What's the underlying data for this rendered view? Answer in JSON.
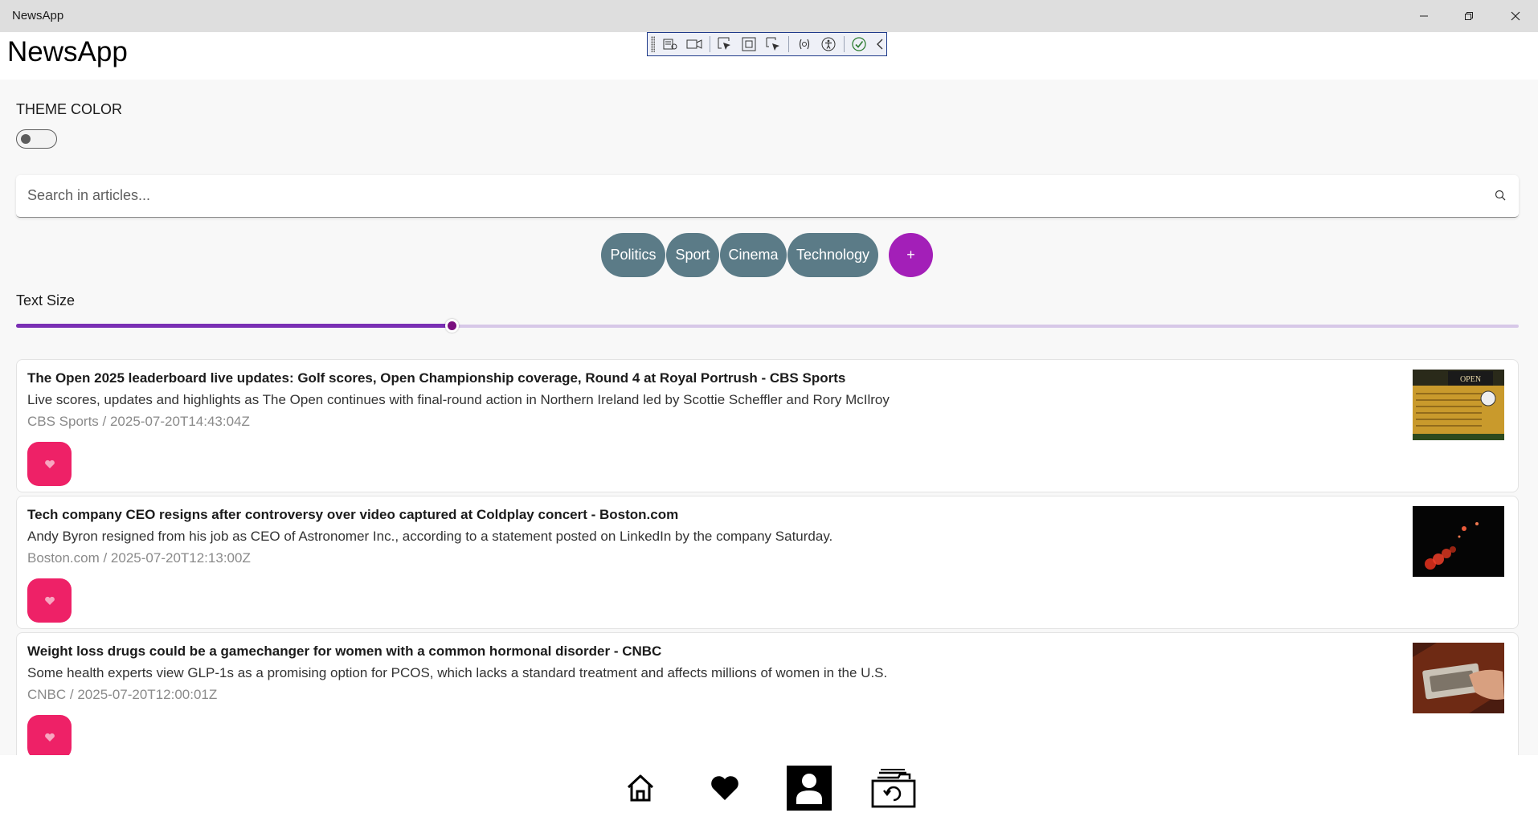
{
  "window": {
    "title": "NewsApp"
  },
  "header": {
    "title": "NewsApp"
  },
  "theme": {
    "label": "THEME COLOR",
    "enabled": false
  },
  "search": {
    "placeholder": "Search in articles..."
  },
  "categories": [
    {
      "label": "Politics"
    },
    {
      "label": "Sport"
    },
    {
      "label": "Cinema"
    },
    {
      "label": "Technology"
    }
  ],
  "add_category": {
    "label": "+"
  },
  "text_size": {
    "label": "Text Size",
    "value_fraction": 0.29
  },
  "articles": [
    {
      "headline": "The Open 2025 leaderboard live updates: Golf scores, Open Championship coverage, Round 4 at Royal Portrush - CBS Sports",
      "description": "Live scores, updates and highlights as The Open continues with final-round action in Northern Ireland led by Scottie Scheffler and Rory McIlroy",
      "meta": "CBS Sports / 2025-07-20T14:43:04Z"
    },
    {
      "headline": "Tech company CEO resigns after controversy over video captured at Coldplay concert - Boston.com",
      "description": "Andy Byron resigned from his job as CEO of Astronomer Inc., according to a statement posted on LinkedIn by the company Saturday.",
      "meta": "Boston.com / 2025-07-20T12:13:00Z"
    },
    {
      "headline": "Weight loss drugs could be a gamechanger for women with a common hormonal disorder - CNBC",
      "description": "Some health experts view GLP-1s as a promising option for PCOS, which lacks a standard treatment and affects millions of women in the U.S.",
      "meta": "CNBC / 2025-07-20T12:00:01Z"
    }
  ],
  "bottom_nav": [
    "home-icon",
    "heart-icon",
    "profile-icon",
    "saved-articles-icon"
  ],
  "colors": {
    "chip": "#5b7b87",
    "add_chip": "#a31fb8",
    "favorite": "#ee2167",
    "slider_fill": "#7a2fb4",
    "slider_thumb": "#7a0f7f"
  }
}
